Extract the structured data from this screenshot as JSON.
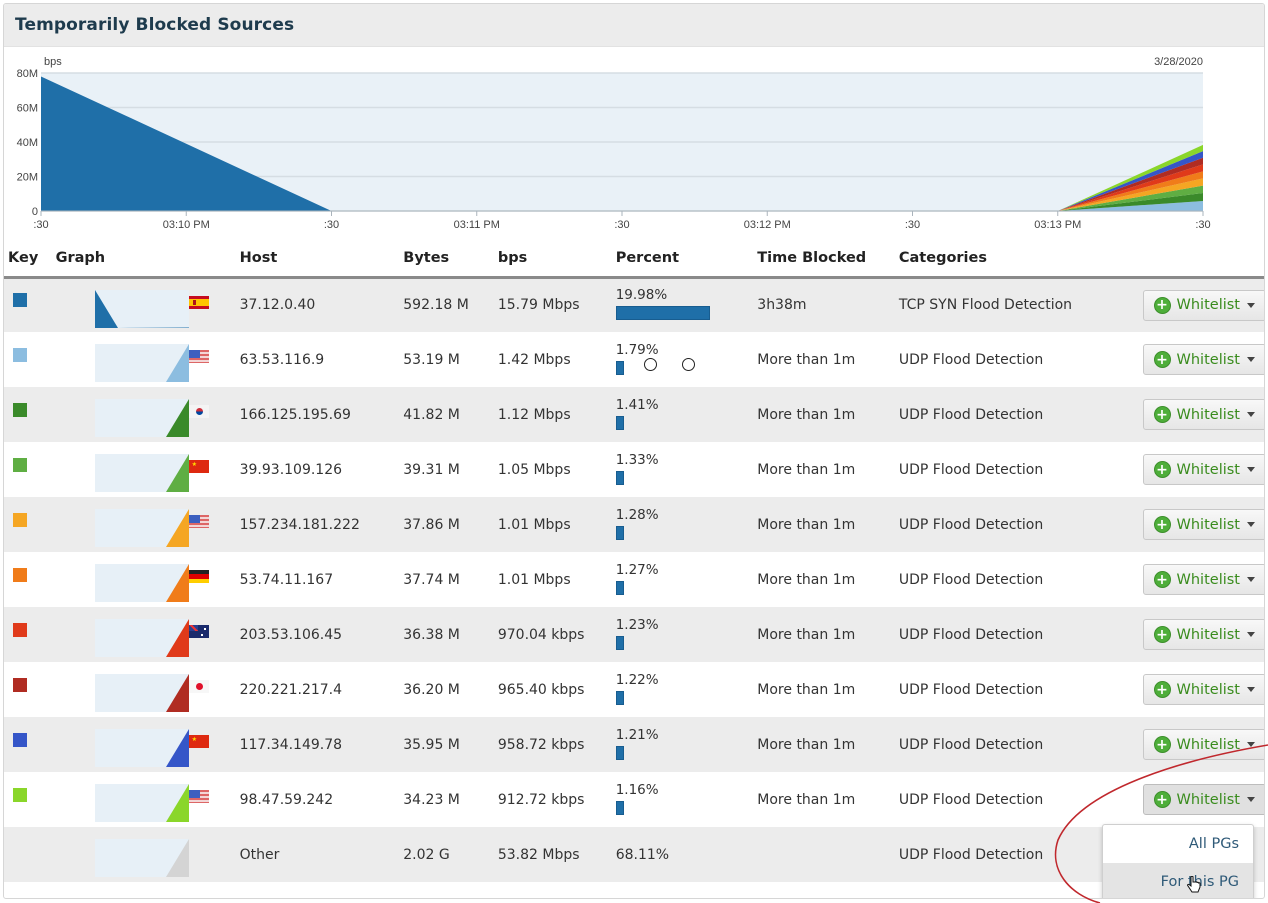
{
  "panel": {
    "title": "Temporarily Blocked Sources"
  },
  "chart_data": {
    "type": "area",
    "title": "",
    "date_label": "3/28/2020",
    "ylabel": "bps",
    "ylim": [
      0,
      80000000
    ],
    "y_ticks": [
      {
        "value": 0,
        "label": "0"
      },
      {
        "value": 20000000,
        "label": "20M"
      },
      {
        "value": 40000000,
        "label": "40M"
      },
      {
        "value": 60000000,
        "label": "60M"
      },
      {
        "value": 80000000,
        "label": "80M"
      }
    ],
    "x_ticks": [
      ":30",
      "03:10 PM",
      ":30",
      "03:11 PM",
      ":30",
      "03:12 PM",
      ":30",
      "03:13 PM",
      ":30"
    ],
    "x": [
      0,
      1,
      2,
      3,
      4,
      5,
      6,
      7,
      8
    ],
    "grid": true,
    "stacked": true,
    "series": [
      {
        "name": "37.12.0.40",
        "color": "#1f6fa8",
        "values": [
          78000000,
          39000000,
          0,
          0,
          0,
          0,
          0,
          0,
          0
        ]
      },
      {
        "name": "63.53.116.9",
        "color": "#8cbde0",
        "values": [
          0,
          0,
          0,
          0,
          0,
          0,
          0,
          0,
          5800000
        ]
      },
      {
        "name": "166.125.195.69",
        "color": "#3a8a2a",
        "values": [
          0,
          0,
          0,
          0,
          0,
          0,
          0,
          0,
          4600000
        ]
      },
      {
        "name": "39.93.109.126",
        "color": "#5fae43",
        "values": [
          0,
          0,
          0,
          0,
          0,
          0,
          0,
          0,
          4300000
        ]
      },
      {
        "name": "157.234.181.222",
        "color": "#f5a623",
        "values": [
          0,
          0,
          0,
          0,
          0,
          0,
          0,
          0,
          4200000
        ]
      },
      {
        "name": "53.74.11.167",
        "color": "#f07c1a",
        "values": [
          0,
          0,
          0,
          0,
          0,
          0,
          0,
          0,
          4100000
        ]
      },
      {
        "name": "203.53.106.45",
        "color": "#e03a1a",
        "values": [
          0,
          0,
          0,
          0,
          0,
          0,
          0,
          0,
          4000000
        ]
      },
      {
        "name": "220.221.217.4",
        "color": "#b02c22",
        "values": [
          0,
          0,
          0,
          0,
          0,
          0,
          0,
          0,
          3900000
        ]
      },
      {
        "name": "117.34.149.78",
        "color": "#3556c8",
        "values": [
          0,
          0,
          0,
          0,
          0,
          0,
          0,
          0,
          3800000
        ]
      },
      {
        "name": "98.47.59.242",
        "color": "#8ad62a",
        "values": [
          0,
          0,
          0,
          0,
          0,
          0,
          0,
          0,
          3600000
        ]
      }
    ]
  },
  "table": {
    "headers": {
      "key": "Key",
      "graph": "Graph",
      "host": "Host",
      "bytes": "Bytes",
      "bps": "bps",
      "percent": "Percent",
      "time_blocked": "Time Blocked",
      "categories": "Categories"
    },
    "rows": [
      {
        "color": "#1f6fa8",
        "flag": "es",
        "host": "37.12.0.40",
        "bytes": "592.18 M",
        "bps": "15.79 Mbps",
        "percent_label": "19.98%",
        "percent": 19.98,
        "time_blocked": "3h38m",
        "category": "TCP SYN Flood Detection",
        "action": "Whitelist",
        "trend": "down"
      },
      {
        "color": "#8cbde0",
        "flag": "us",
        "host": "63.53.116.9",
        "bytes": "53.19 M",
        "bps": "1.42 Mbps",
        "percent_label": "1.79%",
        "percent": 1.79,
        "time_blocked": "More than 1m",
        "category": "UDP Flood Detection",
        "action": "Whitelist",
        "trend": "up"
      },
      {
        "color": "#3a8a2a",
        "flag": "kr",
        "host": "166.125.195.69",
        "bytes": "41.82 M",
        "bps": "1.12 Mbps",
        "percent_label": "1.41%",
        "percent": 1.41,
        "time_blocked": "More than 1m",
        "category": "UDP Flood Detection",
        "action": "Whitelist",
        "trend": "up"
      },
      {
        "color": "#5fae43",
        "flag": "cn",
        "host": "39.93.109.126",
        "bytes": "39.31 M",
        "bps": "1.05 Mbps",
        "percent_label": "1.33%",
        "percent": 1.33,
        "time_blocked": "More than 1m",
        "category": "UDP Flood Detection",
        "action": "Whitelist",
        "trend": "up"
      },
      {
        "color": "#f5a623",
        "flag": "us",
        "host": "157.234.181.222",
        "bytes": "37.86 M",
        "bps": "1.01 Mbps",
        "percent_label": "1.28%",
        "percent": 1.28,
        "time_blocked": "More than 1m",
        "category": "UDP Flood Detection",
        "action": "Whitelist",
        "trend": "up"
      },
      {
        "color": "#f07c1a",
        "flag": "de",
        "host": "53.74.11.167",
        "bytes": "37.74 M",
        "bps": "1.01 Mbps",
        "percent_label": "1.27%",
        "percent": 1.27,
        "time_blocked": "More than 1m",
        "category": "UDP Flood Detection",
        "action": "Whitelist",
        "trend": "up"
      },
      {
        "color": "#e03a1a",
        "flag": "au",
        "host": "203.53.106.45",
        "bytes": "36.38 M",
        "bps": "970.04 kbps",
        "percent_label": "1.23%",
        "percent": 1.23,
        "time_blocked": "More than 1m",
        "category": "UDP Flood Detection",
        "action": "Whitelist",
        "trend": "up"
      },
      {
        "color": "#b02c22",
        "flag": "jp",
        "host": "220.221.217.4",
        "bytes": "36.20 M",
        "bps": "965.40 kbps",
        "percent_label": "1.22%",
        "percent": 1.22,
        "time_blocked": "More than 1m",
        "category": "UDP Flood Detection",
        "action": "Whitelist",
        "trend": "up"
      },
      {
        "color": "#3556c8",
        "flag": "cn",
        "host": "117.34.149.78",
        "bytes": "35.95 M",
        "bps": "958.72 kbps",
        "percent_label": "1.21%",
        "percent": 1.21,
        "time_blocked": "More than 1m",
        "category": "UDP Flood Detection",
        "action": "Whitelist",
        "trend": "up"
      },
      {
        "color": "#8ad62a",
        "flag": "us",
        "host": "98.47.59.242",
        "bytes": "34.23 M",
        "bps": "912.72 kbps",
        "percent_label": "1.16%",
        "percent": 1.16,
        "time_blocked": "More than 1m",
        "category": "UDP Flood Detection",
        "action": "Whitelist",
        "trend": "up"
      }
    ],
    "other": {
      "host": "Other",
      "bytes": "2.02 G",
      "bps": "53.82 Mbps",
      "percent_label": "68.11%",
      "category": "UDP Flood Detection",
      "color": "#d4d4d4"
    }
  },
  "dropdown": {
    "items": [
      "All PGs",
      "For this PG"
    ],
    "hovered": "For this PG"
  }
}
